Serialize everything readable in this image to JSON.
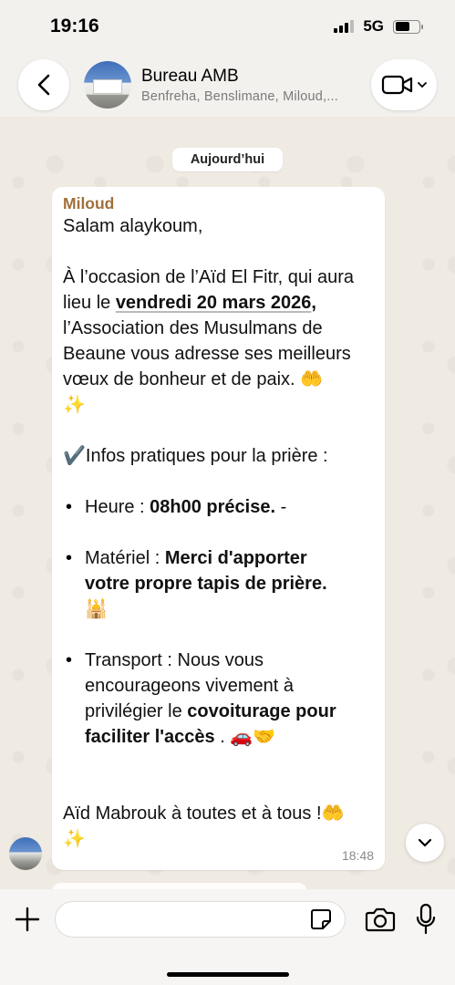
{
  "status_bar": {
    "time": "19:16",
    "network": "5G"
  },
  "header": {
    "title": "Bureau AMB",
    "subtitle": "Benfreha, Benslimane, Miloud,..."
  },
  "date_label": "Aujourd’hui",
  "message": {
    "sender": "Miloud",
    "greeting": "Salam alaykoum,",
    "p1_l1": "À l’occasion de l’Aïd El Fitr, qui aura",
    "p1_l2_pre": "lieu le ",
    "p1_l2_date": "vendredi 20 mars 2026",
    "p1_l2_post": ",",
    "p1_l3": "l’Association des Musulmans de",
    "p1_l4": "Beaune vous adresse ses meilleurs",
    "p1_l5": "vœux de bonheur et de paix. 🤲",
    "p1_l6": "✨",
    "infos_title": "✔️Infos pratiques pour la prière :",
    "heure_label": "Heure : ",
    "heure_value": "08h00 précise.",
    "heure_suffix": " -",
    "materiel_label": "Matériel : ",
    "materiel_value_l1": "Merci d'apporter",
    "materiel_value_l2": "votre propre tapis de prière.",
    "materiel_emoji": "🕌",
    "transport_l1": "Transport : Nous vous",
    "transport_l2": "encourageons vivement à",
    "transport_l3_pre": "privilégier le ",
    "transport_l3_bold": "covoiturage pour",
    "transport_l4_bold": "faciliter l'accès",
    "transport_l4_post": " . 🚗🤝",
    "closing_l1": "Aïd Mabrouk à toutes et à tous !🤲",
    "closing_l2": "✨",
    "time": "18:48"
  }
}
